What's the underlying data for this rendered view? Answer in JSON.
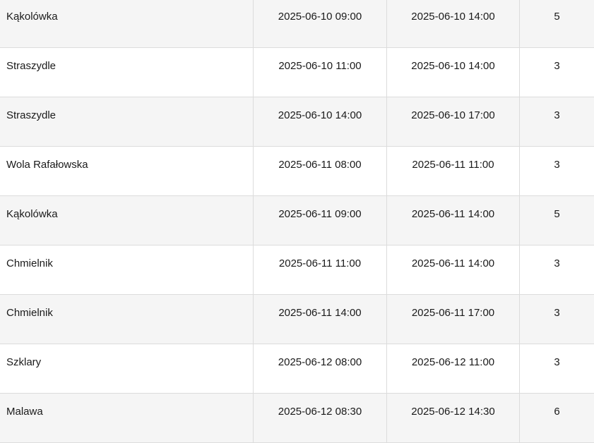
{
  "table": {
    "rows": [
      {
        "location": "Kąkolówka",
        "start": "2025-06-10 09:00",
        "end": "2025-06-10 14:00",
        "qty": "5"
      },
      {
        "location": "Straszydle",
        "start": "2025-06-10 11:00",
        "end": "2025-06-10 14:00",
        "qty": "3"
      },
      {
        "location": "Straszydle",
        "start": "2025-06-10 14:00",
        "end": "2025-06-10 17:00",
        "qty": "3"
      },
      {
        "location": "Wola Rafałowska",
        "start": "2025-06-11 08:00",
        "end": "2025-06-11 11:00",
        "qty": "3"
      },
      {
        "location": "Kąkolówka",
        "start": "2025-06-11 09:00",
        "end": "2025-06-11 14:00",
        "qty": "5"
      },
      {
        "location": "Chmielnik",
        "start": "2025-06-11 11:00",
        "end": "2025-06-11 14:00",
        "qty": "3"
      },
      {
        "location": "Chmielnik",
        "start": "2025-06-11 14:00",
        "end": "2025-06-11 17:00",
        "qty": "3"
      },
      {
        "location": "Szklary",
        "start": "2025-06-12 08:00",
        "end": "2025-06-12 11:00",
        "qty": "3"
      },
      {
        "location": "Malawa",
        "start": "2025-06-12 08:30",
        "end": "2025-06-12 14:30",
        "qty": "6"
      }
    ]
  },
  "colors": {
    "row_alt": "#f5f5f5",
    "row_base": "#ffffff",
    "grid": "#dcdcdc",
    "text": "#1a1a1a"
  }
}
